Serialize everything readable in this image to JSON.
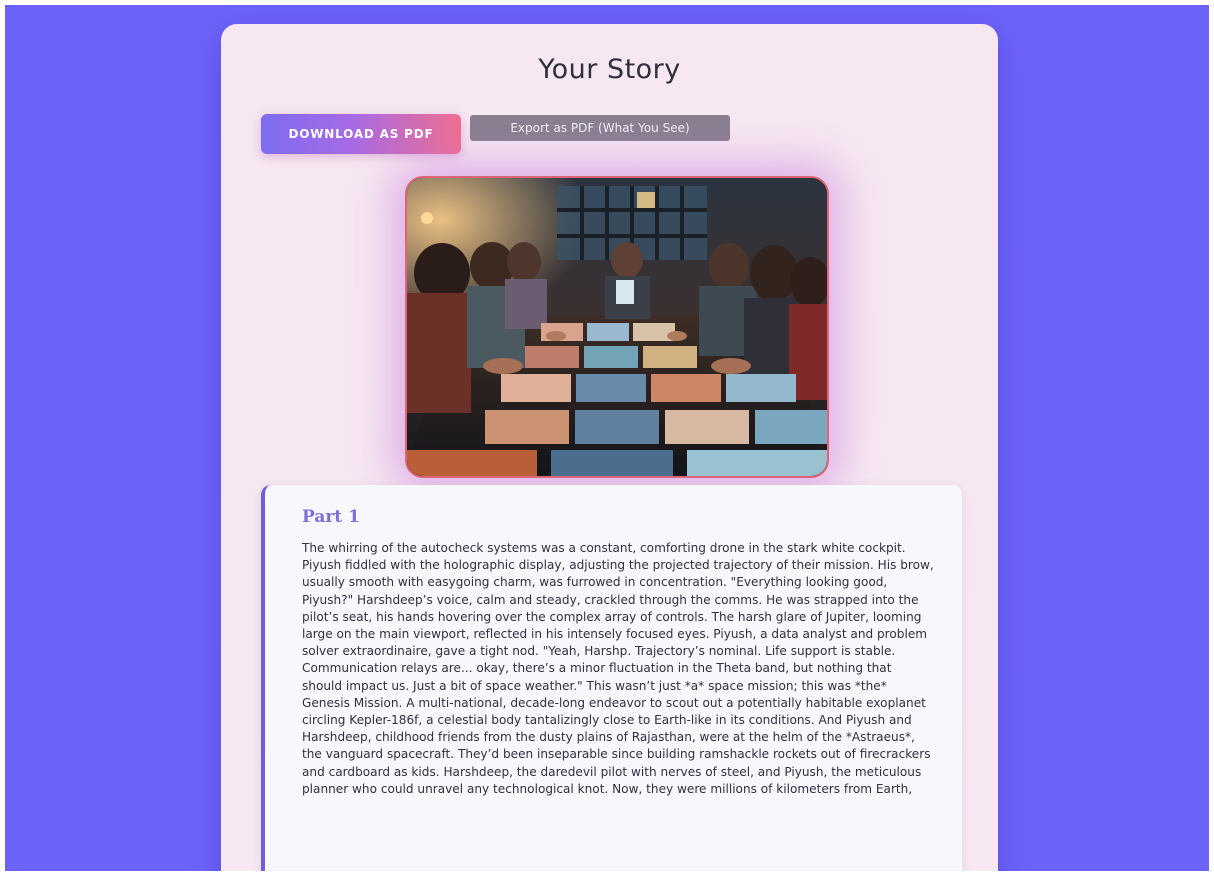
{
  "page": {
    "title": "Your Story",
    "actions": {
      "download_label": "DOWNLOAD AS PDF",
      "export_label": "Export as PDF (What You See)"
    }
  },
  "hero": {
    "alt": "Young people gathered around a table covered with illustrated cards"
  },
  "story": {
    "part_title": "Part 1",
    "body": "The whirring of the autocheck systems was a constant, comforting drone in the stark white cockpit. Piyush fiddled with the holographic display, adjusting the projected trajectory of their mission. His brow, usually smooth with easygoing charm, was furrowed in concentration. \"Everything looking good, Piyush?\" Harshdeep’s voice, calm and steady, crackled through the comms. He was strapped into the pilot’s seat, his hands hovering over the complex array of controls. The harsh glare of Jupiter, looming large on the main viewport, reflected in his intensely focused eyes. Piyush, a data analyst and problem solver extraordinaire, gave a tight nod. \"Yeah, Harshp. Trajectory’s nominal. Life support is stable. Communication relays are... okay, there’s a minor fluctuation in the Theta band, but nothing that should impact us. Just a bit of space weather.\" This wasn’t just *a* space mission; this was *the* Genesis Mission. A multi-national, decade-long endeavor to scout out a potentially habitable exoplanet circling Kepler-186f, a celestial body tantalizingly close to Earth-like in its conditions. And Piyush and Harshdeep, childhood friends from the dusty plains of Rajasthan, were at the helm of the *Astraeus*, the vanguard spacecraft. They’d been inseparable since building ramshackle rockets out of firecrackers and cardboard as kids. Harshdeep, the daredevil pilot with nerves of steel, and Piyush, the meticulous planner who could unravel any technological knot. Now, they were millions of kilometers from Earth,"
  },
  "colors": {
    "background": "#6c63fb",
    "card": "#f6e7f1",
    "accent": "#7d6fd8",
    "download_gradient_start": "#7d6cf1",
    "download_gradient_end": "#ef6f8f",
    "export_button": "#8a7f91",
    "image_border": "#dd6577"
  }
}
